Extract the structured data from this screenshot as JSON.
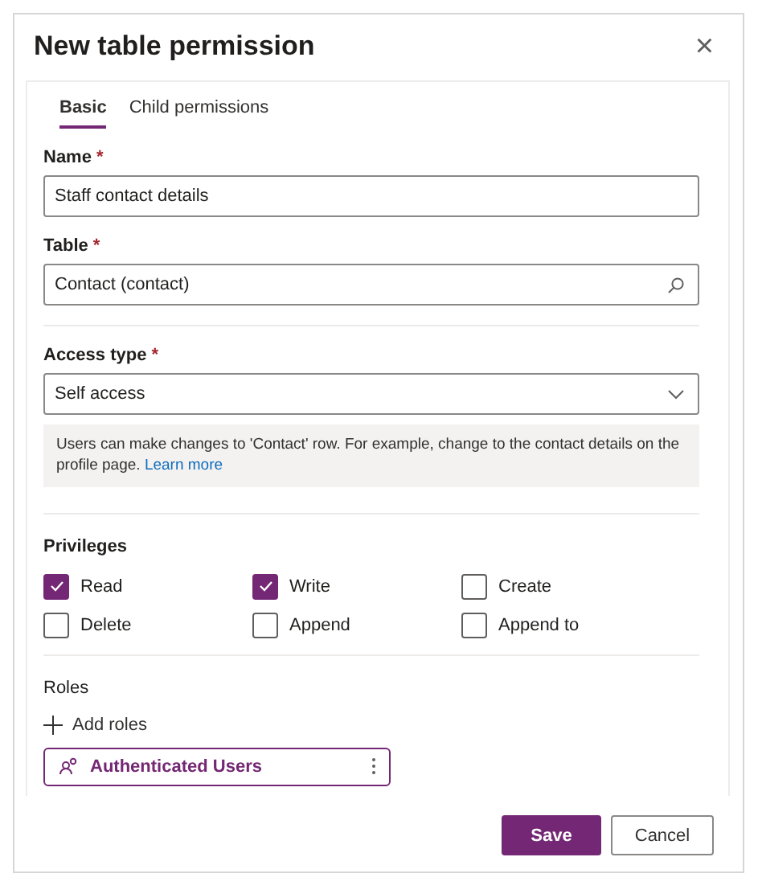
{
  "dialog": {
    "title": "New table permission",
    "close": "×"
  },
  "tabs": [
    {
      "label": "Basic",
      "selected": true
    },
    {
      "label": "Child permissions",
      "selected": false
    }
  ],
  "name_field": {
    "label": "Name",
    "required": "*",
    "value": "Staff contact details"
  },
  "table_field": {
    "label": "Table",
    "required": "*",
    "value": "Contact (contact)"
  },
  "access_type": {
    "label": "Access type",
    "required": "*",
    "value": "Self access",
    "info": "Users can make changes to 'Contact' row. For example, change to the contact details on the profile page.",
    "link": "Learn more"
  },
  "privileges": {
    "label": "Privileges",
    "items": [
      {
        "label": "Read",
        "checked": true
      },
      {
        "label": "Write",
        "checked": true
      },
      {
        "label": "Create",
        "checked": false
      },
      {
        "label": "Delete",
        "checked": false
      },
      {
        "label": "Append",
        "checked": false
      },
      {
        "label": "Append to",
        "checked": false
      }
    ]
  },
  "roles": {
    "label": "Roles",
    "add": "Add roles",
    "items": [
      {
        "label": "Authenticated Users"
      }
    ]
  },
  "buttons": [
    {
      "label": "Save",
      "kind": "primary"
    },
    {
      "label": "Cancel",
      "kind": "secondary"
    }
  ]
}
